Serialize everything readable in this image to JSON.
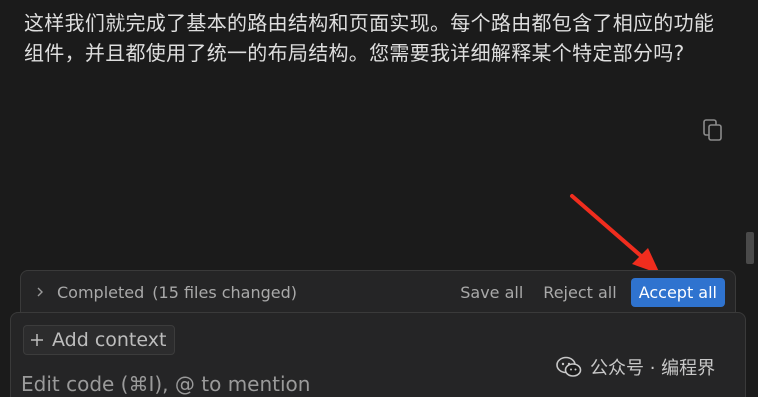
{
  "chat": {
    "message": "这样我们就完成了基本的路由结构和页面实现。每个路由都包含了相应的功能组件，并且都使用了统一的布局结构。您需要我详细解释某个特定部分吗?"
  },
  "changes_bar": {
    "status_label": "Completed",
    "files_changed": "(15 files changed)",
    "save_all_label": "Save all",
    "reject_all_label": "Reject all",
    "accept_all_label": "Accept all"
  },
  "composer": {
    "add_context_label": "Add context",
    "placeholder": "Edit code (⌘I), @ to mention"
  },
  "watermark": {
    "text": "公众号 · 编程界"
  },
  "colors": {
    "background": "#1b1b1b",
    "accent": "#2f73cf",
    "annotation_arrow": "#f02d1e"
  }
}
